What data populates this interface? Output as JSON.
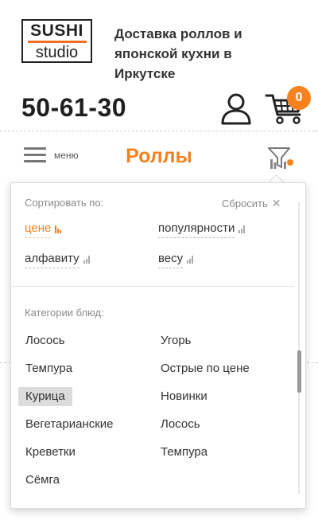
{
  "header": {
    "logo_top": "SUSHI",
    "logo_bottom": "studio",
    "tagline": "Доставка роллов и японской кухни в Иркутске",
    "phone": "50-61-30",
    "cart_count": "0"
  },
  "nav": {
    "menu_label": "меню",
    "page_title": "Роллы"
  },
  "filter_panel": {
    "sort_label": "Сортировать по:",
    "reset_label": "Сбросить",
    "sort_options": [
      {
        "label": "цене",
        "active": true
      },
      {
        "label": "популярности",
        "active": false
      },
      {
        "label": "алфавиту",
        "active": false
      },
      {
        "label": "весу",
        "active": false
      }
    ],
    "categories_label": "Категории блюд:",
    "categories": [
      {
        "label": "Лосось",
        "selected": false
      },
      {
        "label": "Угорь",
        "selected": false
      },
      {
        "label": "Темпура",
        "selected": false
      },
      {
        "label": "Острые по цене",
        "selected": false
      },
      {
        "label": "Курица",
        "selected": true
      },
      {
        "label": "Новинки",
        "selected": false
      },
      {
        "label": "Вегетарианские",
        "selected": false
      },
      {
        "label": "Лосось",
        "selected": false
      },
      {
        "label": "Креветки",
        "selected": false
      },
      {
        "label": "Темпура",
        "selected": false
      },
      {
        "label": "Сёмга",
        "selected": false
      }
    ]
  },
  "colors": {
    "accent": "#f5821f",
    "text": "#333333",
    "muted": "#8a8a8a"
  },
  "icons": {
    "user": "user-icon",
    "cart": "cart-icon",
    "menu": "hamburger-icon",
    "filter": "filter-icon",
    "reset": "close-icon",
    "sort": "bar-chart-icon"
  }
}
